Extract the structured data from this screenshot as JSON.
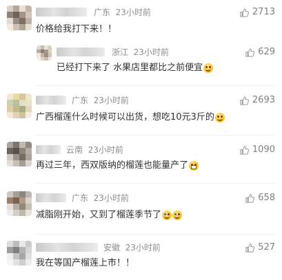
{
  "comments": [
    {
      "location": "广东",
      "time": "23小时前",
      "likes": "2713",
      "text": "价格给我打下来！！"
    },
    {
      "location": "浙江",
      "time": "23小时前",
      "likes": "629",
      "text": "已经打下来了 水果店里都比之前便宜",
      "emoji": "party-face-emoji"
    },
    {
      "location": "广东",
      "time": "23小时前",
      "likes": "2693",
      "text": "广西榴莲什么时候可以出货，想吃10元3斤的",
      "emoji": "heart-eyes-emoji"
    },
    {
      "location": "云南",
      "time": "23小时前",
      "likes": "1090",
      "text": "再过三年，西双版纳的榴莲也能量产了",
      "emoji": "grin-emoji"
    },
    {
      "location": "广东",
      "time": "23小时前",
      "likes": "658",
      "text": "减脂刚开始，又到了榴莲季节了",
      "emoji": "crying-emoji"
    },
    {
      "location": "安徽",
      "time": "23小时前",
      "likes": "527",
      "text": "我在等国产榴莲上市！！"
    }
  ],
  "icons": {
    "like": "thumbs-up-icon"
  }
}
